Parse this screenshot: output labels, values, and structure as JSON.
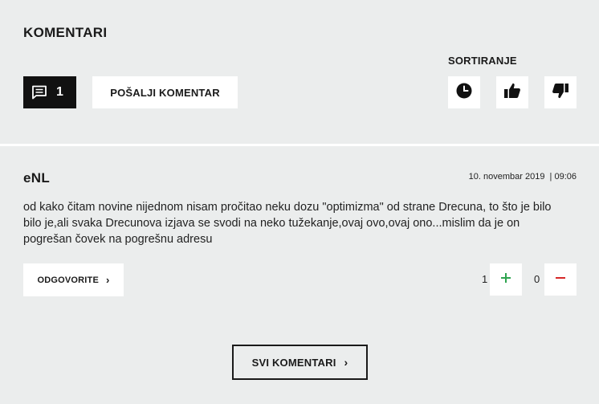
{
  "section": {
    "title": "KOMENTARI",
    "sort_label": "SORTIRANJE"
  },
  "toolbar": {
    "comment_count": "1",
    "send_label": "POŠALJI KOMENTAR",
    "sort_options": [
      "clock-icon",
      "thumbs-up-icon",
      "thumbs-down-icon"
    ]
  },
  "comment": {
    "author": "eNL",
    "timestamp": "10. novembar 2019  | 09:06",
    "text": "od kako čitam novine nijednom nisam pročitao neku dozu \"optimizma\" od strane Drecuna, to što je bilo bilo je,ali svaka Drecunova izjava se svodi na neko tužekanje,ovaj ovo,ovaj ono...mislim da je on pogrešan čovek na pogrešnu adresu",
    "reply_label": "ODGOVORITE",
    "reply_chevron": "›",
    "likes": "1",
    "dislikes": "0"
  },
  "footer": {
    "all_comments_label": "SVI KOMENTARI",
    "chevron": "›"
  },
  "colors": {
    "background": "#ebeded",
    "plus": "#2ea44f",
    "minus": "#d62828"
  }
}
